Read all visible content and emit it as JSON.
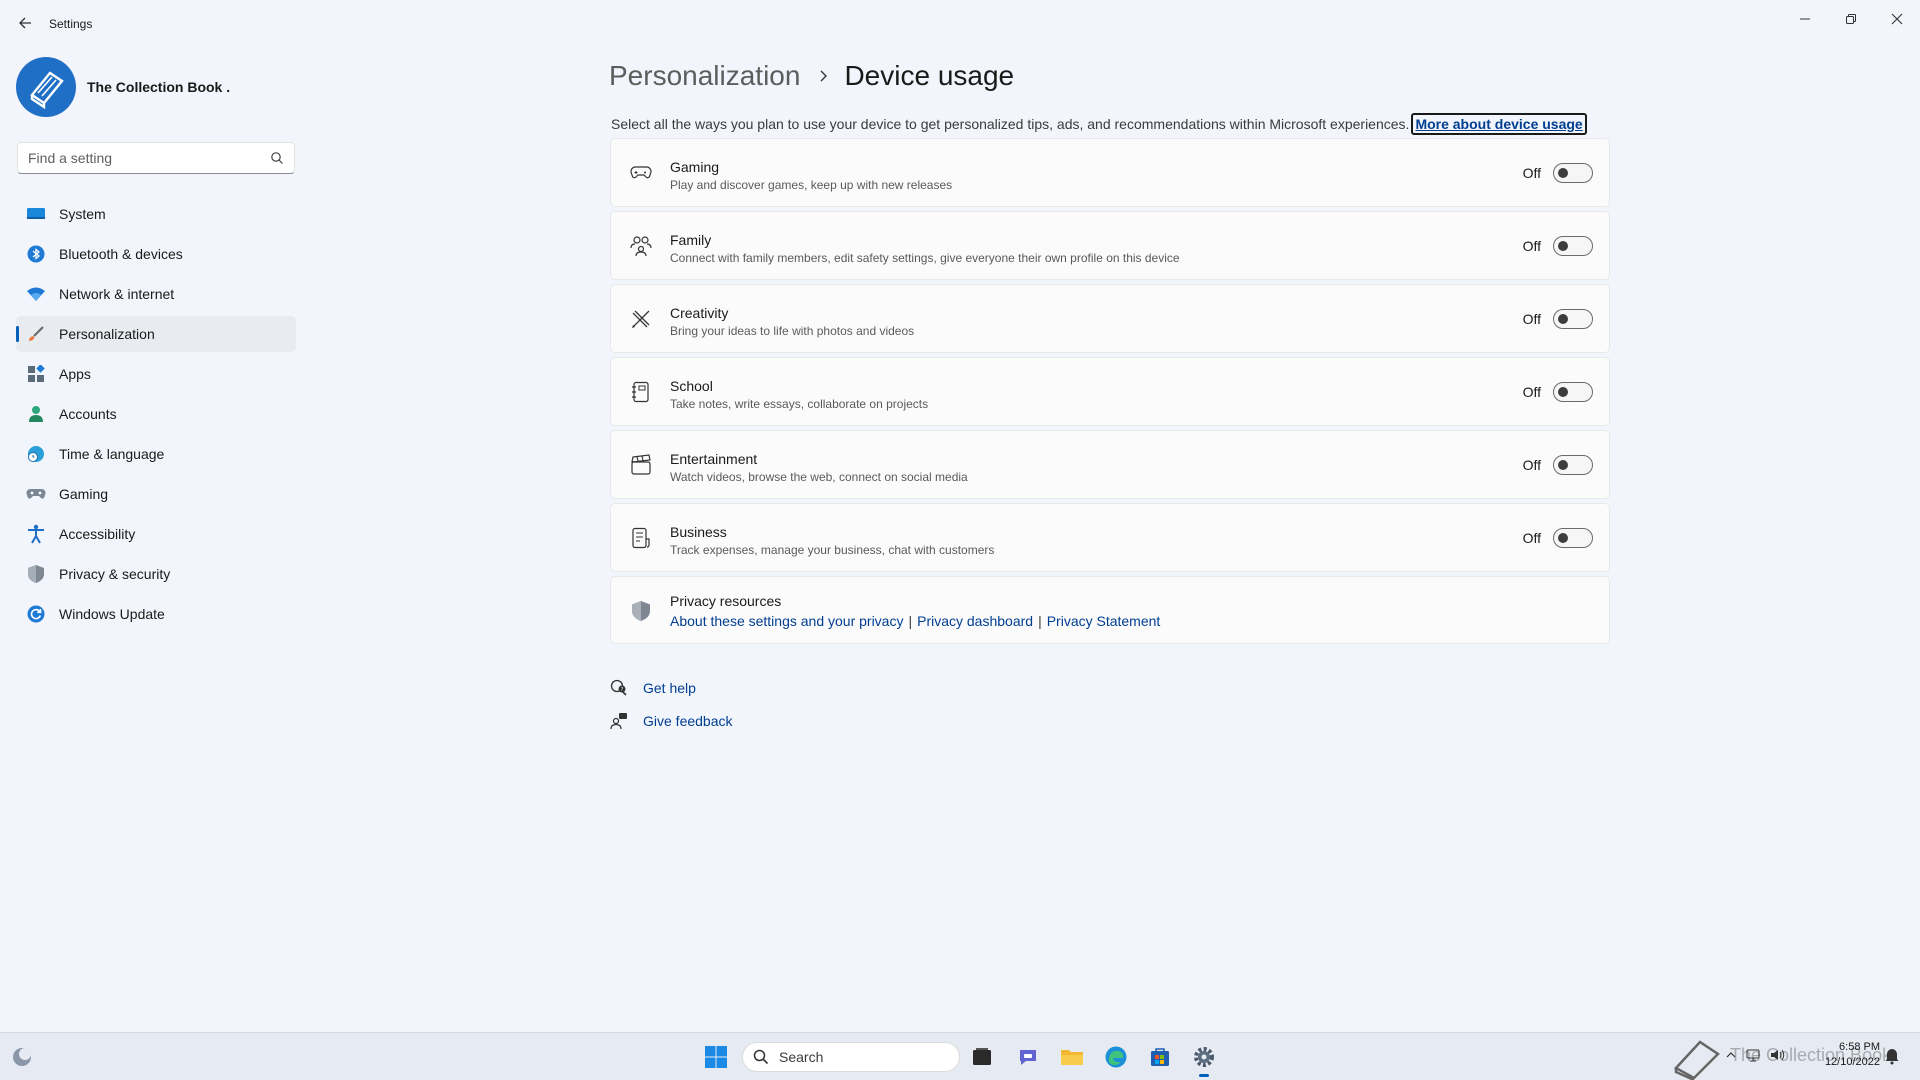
{
  "window": {
    "app_title": "Settings",
    "controls": {
      "minimize": "minimize-icon",
      "maximize": "restore-icon",
      "close": "close-icon"
    }
  },
  "profile": {
    "name": "The Collection Book ."
  },
  "search": {
    "placeholder": "Find a setting"
  },
  "sidebar": {
    "items": [
      {
        "label": "System",
        "icon": "monitor-icon"
      },
      {
        "label": "Bluetooth & devices",
        "icon": "bluetooth-icon"
      },
      {
        "label": "Network & internet",
        "icon": "wifi-icon"
      },
      {
        "label": "Personalization",
        "icon": "brush-icon",
        "active": true
      },
      {
        "label": "Apps",
        "icon": "apps-icon"
      },
      {
        "label": "Accounts",
        "icon": "person-icon"
      },
      {
        "label": "Time & language",
        "icon": "globe-clock-icon"
      },
      {
        "label": "Gaming",
        "icon": "gamepad-icon"
      },
      {
        "label": "Accessibility",
        "icon": "accessibility-icon"
      },
      {
        "label": "Privacy & security",
        "icon": "shield-icon"
      },
      {
        "label": "Windows Update",
        "icon": "update-icon"
      }
    ]
  },
  "breadcrumb": {
    "parent": "Personalization",
    "current": "Device usage"
  },
  "intro": {
    "text": "Select all the ways you plan to use your device to get personalized tips, ads, and recommendations within Microsoft experiences.",
    "link": "More about device usage"
  },
  "usages": [
    {
      "title": "Gaming",
      "desc": "Play and discover games, keep up with new releases",
      "state": "Off",
      "icon": "gamepad-icon"
    },
    {
      "title": "Family",
      "desc": "Connect with family members, edit safety settings, give everyone their own profile on this device",
      "state": "Off",
      "icon": "family-icon"
    },
    {
      "title": "Creativity",
      "desc": "Bring your ideas to life with photos and videos",
      "state": "Off",
      "icon": "pen-ruler-icon"
    },
    {
      "title": "School",
      "desc": "Take notes, write essays, collaborate on projects",
      "state": "Off",
      "icon": "notebook-icon"
    },
    {
      "title": "Entertainment",
      "desc": "Watch videos, browse the web, connect on social media",
      "state": "Off",
      "icon": "clapperboard-icon"
    },
    {
      "title": "Business",
      "desc": "Track expenses, manage your business, chat with customers",
      "state": "Off",
      "icon": "receipt-icon"
    }
  ],
  "privacy": {
    "title": "Privacy resources",
    "links": [
      "About these settings and your privacy",
      "Privacy dashboard",
      "Privacy Statement"
    ]
  },
  "help": {
    "get_help": "Get help",
    "give_feedback": "Give feedback"
  },
  "taskbar": {
    "search_label": "Search",
    "time": "6:58 PM",
    "date": "12/10/2022",
    "watermark": "The Collection Book"
  },
  "colors": {
    "accent": "#005fb8",
    "link": "#003e92",
    "background": "#f2f5fb"
  }
}
